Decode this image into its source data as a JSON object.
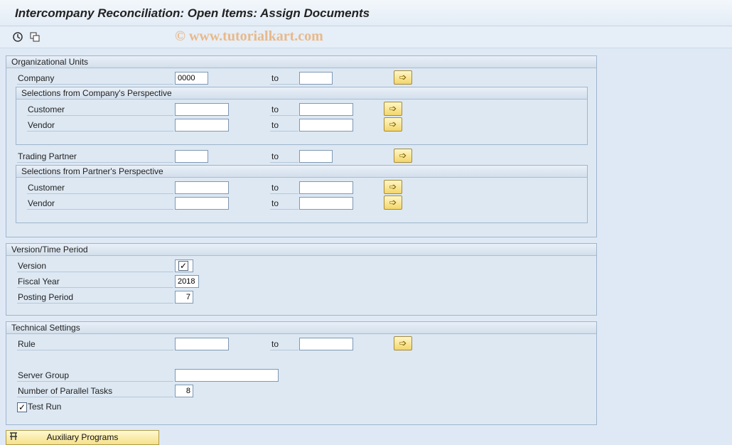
{
  "title": "Intercompany Reconciliation: Open Items: Assign Documents",
  "watermark": "© www.tutorialkart.com",
  "toolbar": {
    "icons": [
      "execute-icon",
      "variant-icon"
    ]
  },
  "org_units": {
    "header": "Organizational Units",
    "company": {
      "label": "Company",
      "from": "0000",
      "to_label": "to",
      "to": ""
    },
    "company_perspective": {
      "header": "Selections from Company's Perspective",
      "customer": {
        "label": "Customer",
        "from": "",
        "to_label": "to",
        "to": ""
      },
      "vendor": {
        "label": "Vendor",
        "from": "",
        "to_label": "to",
        "to": ""
      }
    },
    "trading_partner": {
      "label": "Trading Partner",
      "from": "",
      "to_label": "to",
      "to": ""
    },
    "partner_perspective": {
      "header": "Selections from Partner's Perspective",
      "customer": {
        "label": "Customer",
        "from": "",
        "to_label": "to",
        "to": ""
      },
      "vendor": {
        "label": "Vendor",
        "from": "",
        "to_label": "to",
        "to": ""
      }
    }
  },
  "version_period": {
    "header": "Version/Time Period",
    "version": {
      "label": "Version",
      "checked": true
    },
    "fiscal_year": {
      "label": "Fiscal Year",
      "value": "2018"
    },
    "posting_period": {
      "label": "Posting Period",
      "value": "7"
    }
  },
  "technical": {
    "header": "Technical Settings",
    "rule": {
      "label": "Rule",
      "from": "",
      "to_label": "to",
      "to": ""
    },
    "server_group": {
      "label": "Server Group",
      "value": ""
    },
    "parallel_tasks": {
      "label": "Number of Parallel Tasks",
      "value": "8"
    },
    "test_run": {
      "label": "Test Run",
      "checked": true
    }
  },
  "aux_button": {
    "label": "Auxiliary Programs"
  }
}
